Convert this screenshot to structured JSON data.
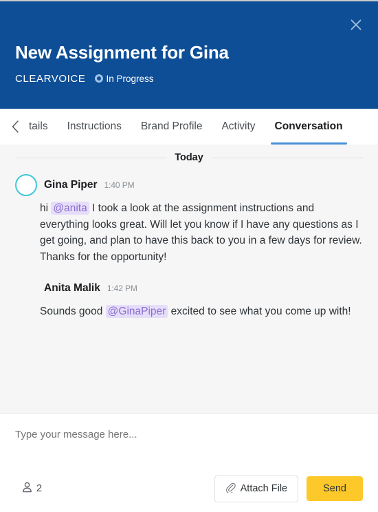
{
  "window": {
    "close_icon": "close-icon"
  },
  "header": {
    "title": "New Assignment for Gina",
    "brand": "CLEARVOICE",
    "status_label": "In Progress",
    "bg_color": "#0d4e96",
    "status_dot_color": "#9fc4e8"
  },
  "tabs": {
    "scroll_left_icon": "chevron-left-icon",
    "items": [
      {
        "label": "tails",
        "active": false
      },
      {
        "label": "Instructions",
        "active": false
      },
      {
        "label": "Brand Profile",
        "active": false
      },
      {
        "label": "Activity",
        "active": false
      },
      {
        "label": "Conversation",
        "active": true
      }
    ],
    "active_underline_color": "#4a90d9"
  },
  "conversation": {
    "day_divider": "Today",
    "messages": [
      {
        "author": "Gina Piper",
        "time": "1:40 PM",
        "avatar_ring_color": "#3fc8d6",
        "text_before_mention": "hi ",
        "mention": "@anita",
        "text_after_mention": " I took a look at the assignment instructions and everything looks great. Will let you know if I have any questions as I get going, and plan to have this back to you in a few days for review. Thanks for the opportunity!"
      },
      {
        "author": "Anita Malik",
        "time": "1:42 PM",
        "avatar_ring_color": "",
        "text_before_mention": "Sounds good ",
        "mention": "@GinaPiper",
        "text_after_mention": " excited to see what you come up with!"
      }
    ],
    "mention_bg_color": "#e6ddfa",
    "mention_text_color": "#8a6ed0",
    "bg_color": "#f6f6f6"
  },
  "composer": {
    "placeholder": "Type your message here...",
    "value": "",
    "participants_icon": "person-icon",
    "participants_count": "2",
    "attach_icon": "paperclip-icon",
    "attach_label": "Attach File",
    "send_label": "Send",
    "send_color": "#fdc82a"
  }
}
